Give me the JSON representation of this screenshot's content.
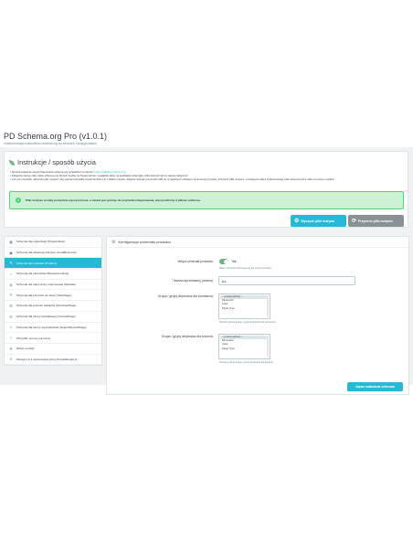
{
  "header": {
    "title": "PD Schema.org Pro (v1.0.1)",
    "subtitle": "Implementacja znaczników schema.org na stronach Twojego sklepu"
  },
  "instructions": {
    "title": "Instrukcje / sposób użycia",
    "bullets": [
      {
        "text": "Sposób zapisania więcej fragmentów schema.org sprawdzisz na stronie: ",
        "link": "https://validator.schema.org"
      },
      {
        "text": "Kategorie więcej mikro-dane schema.org, których będzie na Twojej stronie i wyglądzie dane na podstawie schemata, mikro-danych strony więcej zobaczysz",
        "link": ""
      },
      {
        "text": "Lub ucz przycisku „Wyczyść pliki motywu” aby usunąć wszystkie znaczniki SCH-LD z plików motywu. Zawsze możesz przywrócić pliki do oryginalnych ustawień za pomocą przycisku „Przywróć pliki motywu”, a następnie włącz implementację mikro-danych przez mikro-w nowym module.",
        "link": ""
      }
    ],
    "success": "Pliki motywu zostały pomyślnie wyczyszczone, a moduł jest gotowy do użycia/skonfigurowania, wyczyściliśmy 3 plików szablonu.",
    "clean_button": "Wyczyść pliki motywu",
    "restore_button": "Przywróć pliki motywu"
  },
  "sidebar": {
    "items": [
      {
        "label": "Schemat dla organizacji (Organization)",
        "icon": "building-icon",
        "active": false
      },
      {
        "label": "Schemat dla lokalnego biznesu (LocalBusiness)",
        "icon": "store-icon",
        "active": false
      },
      {
        "label": "Schemat dla produktu (Product)",
        "icon": "pencil-icon",
        "active": true
      },
      {
        "label": "Schemat dla okruszków (BreadcrumbList)",
        "icon": "dot-icon",
        "active": false
      },
      {
        "label": "Schemat dla całej strony internetowej (Website)",
        "icon": "globe-icon",
        "active": false
      },
      {
        "label": "Schemat dla przyciski ref strony (WebPage)",
        "icon": "pencil-icon",
        "active": false
      },
      {
        "label": "Schemat dla procesu zakupów (CheckoutPage)",
        "icon": "cart-icon",
        "active": false
      },
      {
        "label": "Schemat dla strony kontaktowej (ContactPage)",
        "icon": "envelope-icon",
        "active": false
      },
      {
        "label": "Schemat dla strony wyszukiwania (SearchResultsPage)",
        "icon": "search-icon",
        "active": false
      },
      {
        "label": "Wszystki; pomoc pomocną",
        "icon": "help-icon",
        "active": false
      },
      {
        "label": "Nasze moduły",
        "icon": "gear-icon",
        "active": false
      },
      {
        "label": "Wersja 1.0.1 opracowana przez PrestaShoppl.pl",
        "icon": "info-icon",
        "active": false
      }
    ]
  },
  "config": {
    "title": "Konfiguracja schematu produktu",
    "enable_label": "Włącz schemat produktu",
    "enable_value": "Tak",
    "enable_help": "Włącz schemat schemata.org dla strony produktu",
    "name_label": "Nazwa sprzedawcy (marka)",
    "name_value": "Brit",
    "size_label": "Grupa / grupy atrybutów dla rozmiarów",
    "size_options": [
      "-- proszę wybrać --",
      "Dimension",
      "Color",
      "Paper Type"
    ],
    "size_help": "Proszę wybrać grupę / grupy atrybutów dla rozmiarów",
    "color_label": "Grupa / grupy atrybutów dla kolorów",
    "color_options": [
      "-- proszę wybrać --",
      "Dimension",
      "Color",
      "Paper Type"
    ],
    "color_help": "Proszę wybrać grupę / grupy atrybutów dla kolorów",
    "save_label": "Zapisz ustawienia schematu"
  },
  "colors": {
    "accent": "#25b9d7",
    "success": "#53d572",
    "toggle": "#70b580"
  }
}
